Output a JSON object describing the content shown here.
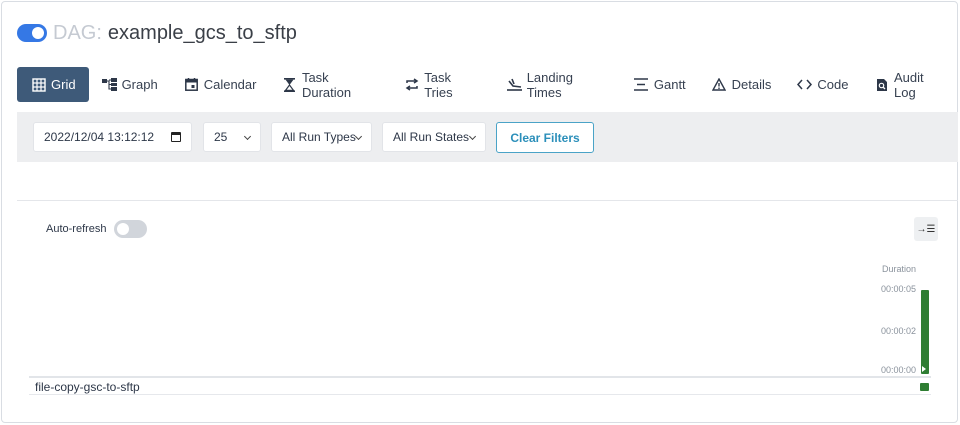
{
  "header": {
    "dag_label": "DAG:",
    "dag_id": "example_gcs_to_sftp"
  },
  "tabs": [
    {
      "label": "Grid",
      "icon": "grid-icon"
    },
    {
      "label": "Graph",
      "icon": "graph-icon"
    },
    {
      "label": "Calendar",
      "icon": "calendar-icon"
    },
    {
      "label": "Task Duration",
      "icon": "hourglass-icon"
    },
    {
      "label": "Task Tries",
      "icon": "retry-icon"
    },
    {
      "label": "Landing Times",
      "icon": "landing-icon"
    },
    {
      "label": "Gantt",
      "icon": "gantt-icon"
    },
    {
      "label": "Details",
      "icon": "warning-triangle-icon"
    },
    {
      "label": "Code",
      "icon": "code-icon"
    },
    {
      "label": "Audit Log",
      "icon": "audit-log-icon"
    }
  ],
  "filters": {
    "date_value": "2022/12/04 13:12:12",
    "num_runs": "25",
    "run_types": "All Run Types",
    "run_states": "All Run States",
    "clear_label": "Clear Filters"
  },
  "grid": {
    "auto_refresh_label": "Auto-refresh",
    "auto_refresh_on": false,
    "expand_icon": "→☰",
    "duration_label": "Duration",
    "ticks": [
      "00:00:05",
      "00:00:02",
      "00:00:00"
    ],
    "run_duration_seconds": 5,
    "run_state_color": "#2e7d32",
    "tasks": [
      {
        "name": "file-copy-gsc-to-sftp",
        "state_color": "#2e7d32"
      }
    ]
  },
  "colors": {
    "active_tab": "#3e5a79",
    "toggle_on": "#3578e5",
    "success": "#2e7d32",
    "clear_filters": "#2b8fba"
  }
}
